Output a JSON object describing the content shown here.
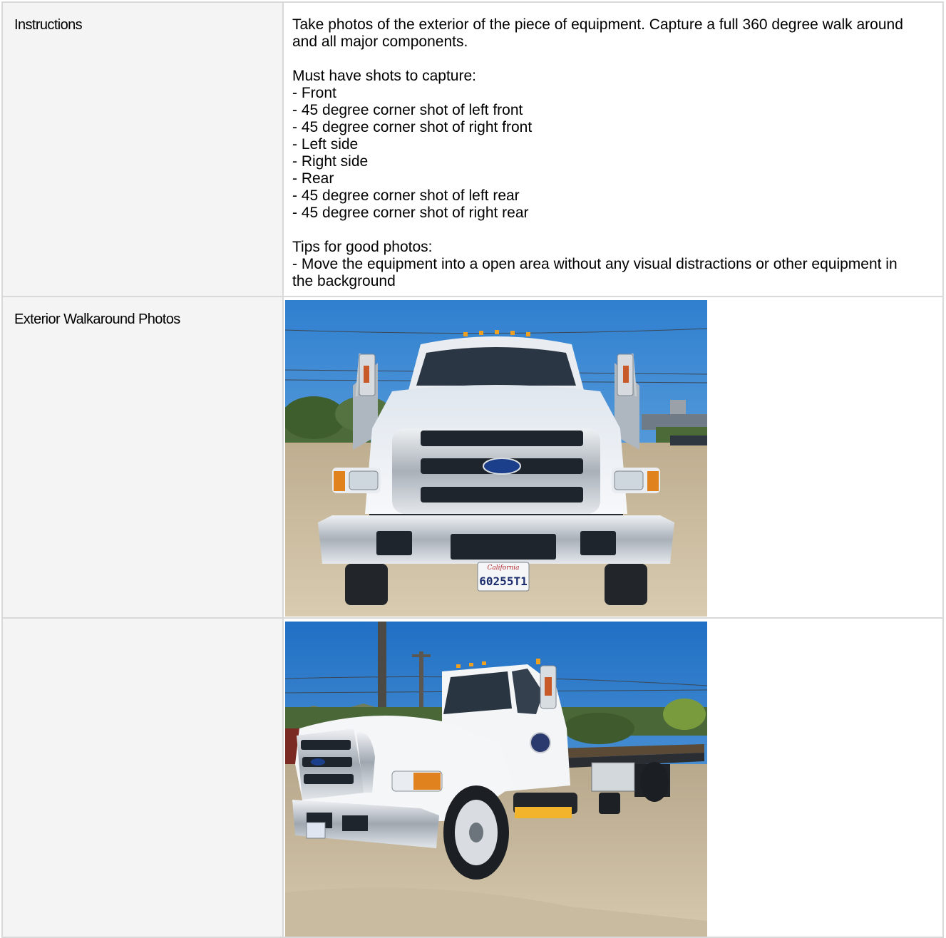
{
  "rows": [
    {
      "label": "Instructions",
      "text": "Take photos of the exterior of the piece of equipment. Capture a full 360 degree walk around and all major components.\n\nMust have shots to capture:\n- Front\n- 45 degree corner shot of left front\n- 45 degree corner shot of right front\n- Left side\n- Right side\n- Rear\n- 45 degree corner shot of left rear\n- 45 degree corner shot of right rear\n\nTips for good photos:\n- Move the equipment into a open area without any visual distractions or other equipment in the background"
    },
    {
      "label": "Exterior Walkaround Photos",
      "photo": {
        "subject": "front-view-tow-truck",
        "plate_state": "California",
        "plate_number": "60255T1"
      }
    },
    {
      "label": "",
      "photo": {
        "subject": "left-front-corner-view-rollback-tow-truck"
      }
    }
  ],
  "colors": {
    "border": "#d9d9d9",
    "label_background": "#f4f4f4",
    "sky": "#3f8fd6",
    "truck_white": "#f1f2f2",
    "chrome": "#c9ced3",
    "dirt": "#c8b79a"
  }
}
